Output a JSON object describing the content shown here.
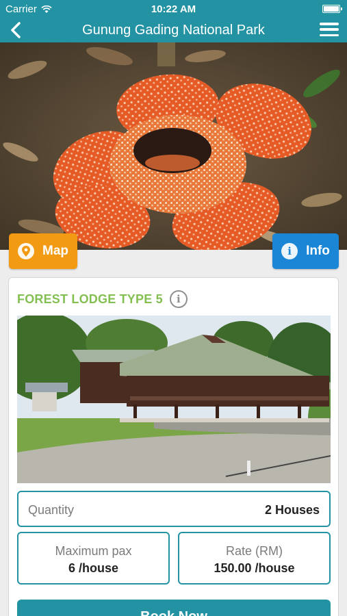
{
  "status_bar": {
    "carrier": "Carrier",
    "time": "10:22 AM",
    "icons": [
      "wifi-icon",
      "battery-icon"
    ]
  },
  "nav": {
    "title": "Gunung Gading National Park",
    "back_icon": "chevron-left-icon",
    "menu_icon": "hamburger-menu-icon"
  },
  "hero": {
    "image": "rafflesia-flower-photo"
  },
  "buttons": {
    "map_label": "Map",
    "map_icon": "location-pin-icon",
    "info_label": "Info",
    "info_icon": "info-icon"
  },
  "lodge": {
    "name": "FOREST LODGE TYPE 5",
    "info_icon": "info-icon",
    "image": "forest-lodge-photo",
    "quantity_label": "Quantity",
    "quantity_value": "2 Houses",
    "max_pax_label": "Maximum pax",
    "max_pax_value": "6 /house",
    "rate_label": "Rate (RM)",
    "rate_value": "150.00 /house",
    "book_label": "Book Now"
  },
  "colors": {
    "primary": "#2393a3",
    "map_button": "#f29a12",
    "info_button": "#1b86d6",
    "lodge_title": "#84bf52"
  }
}
